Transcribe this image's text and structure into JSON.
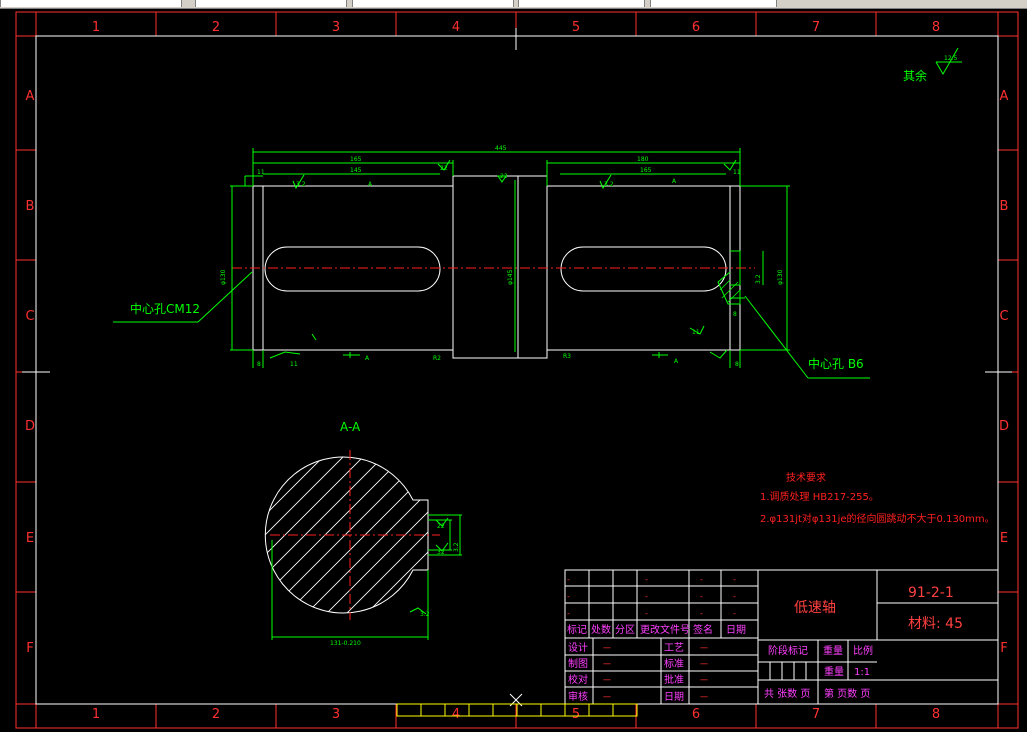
{
  "toolbar": {
    "tabs": [
      "",
      "",
      "",
      "",
      ""
    ]
  },
  "frame": {
    "columns": [
      "1",
      "2",
      "3",
      "4",
      "5",
      "6",
      "7",
      "8"
    ],
    "rows": [
      "A",
      "B",
      "C",
      "D",
      "E",
      "F"
    ]
  },
  "drawing": {
    "roughness_note": "其余",
    "roughness_value": "12.5",
    "overall_length": "445",
    "left_section": "165",
    "left_keyway_length": "145",
    "right_section": "180",
    "right_keyway_length": "165",
    "left_end_length": "11",
    "right_end_length": "11",
    "shoulder_marker": "22",
    "section_marker": "A",
    "left_center_hole": "中心孔CM12",
    "right_center_hole": "中心孔 B6",
    "fillet_left": "R2",
    "fillet_right": "R3",
    "dia_left": "φ130",
    "dia_mid": "φ145",
    "dia_right": "φ130",
    "chamfer": "8",
    "section_title": "A-A",
    "section_dia": "131-0.210",
    "key_width": "32",
    "key_depth": "22",
    "roughness_small": "3.2"
  },
  "tech_requirements": {
    "title": "技术要求",
    "items": [
      "1.调质处理 HB217-255。",
      "2.φ131jt对φ131je的径向圆跳动不大于0.130mm。"
    ]
  },
  "title_block": {
    "part_name": "低速轴",
    "drawing_number": "91-2-1",
    "material": "材料: 45",
    "revision_headers": [
      "标记",
      "处数",
      "分区",
      "更改文件号",
      "签名",
      "日期"
    ],
    "sign_rows": [
      {
        "left": "设计",
        "right": "工艺"
      },
      {
        "left": "制图",
        "right": "标准"
      },
      {
        "left": "校对",
        "right": "批准"
      },
      {
        "left": "审核",
        "right": "日期"
      }
    ],
    "stage_label": "阶段标记",
    "weight_label": "重量",
    "scale_label": "比例",
    "weight_val": "重量",
    "scale_val": "1:1",
    "sheets_total": "共  张数  页",
    "sheet_no": "第  页数  页"
  }
}
